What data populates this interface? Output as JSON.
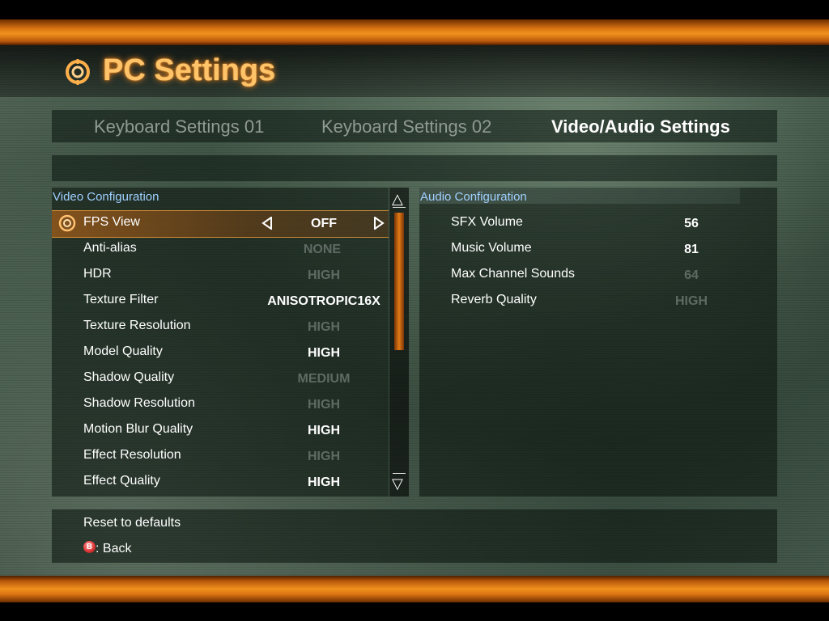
{
  "title": "PC Settings",
  "tabs": [
    {
      "label": "Keyboard Settings 01",
      "active": false
    },
    {
      "label": "Keyboard Settings 02",
      "active": false
    },
    {
      "label": "Video/Audio Settings",
      "active": true
    }
  ],
  "video": {
    "title": "Video Configuration",
    "rows": [
      {
        "label": "FPS View",
        "value": "OFF",
        "enabled": true,
        "selected": true
      },
      {
        "label": "Anti-alias",
        "value": "NONE",
        "enabled": false
      },
      {
        "label": "HDR",
        "value": "HIGH",
        "enabled": false
      },
      {
        "label": "Texture Filter",
        "value": "ANISOTROPIC16X",
        "enabled": true
      },
      {
        "label": "Texture Resolution",
        "value": "HIGH",
        "enabled": false
      },
      {
        "label": "Model Quality",
        "value": "HIGH",
        "enabled": true
      },
      {
        "label": "Shadow Quality",
        "value": "MEDIUM",
        "enabled": false
      },
      {
        "label": "Shadow Resolution",
        "value": "HIGH",
        "enabled": false
      },
      {
        "label": "Motion Blur Quality",
        "value": "HIGH",
        "enabled": true
      },
      {
        "label": "Effect Resolution",
        "value": "HIGH",
        "enabled": false
      },
      {
        "label": "Effect Quality",
        "value": "HIGH",
        "enabled": true
      }
    ]
  },
  "audio": {
    "title": "Audio Configuration",
    "rows": [
      {
        "label": "SFX Volume",
        "value": "56",
        "enabled": true
      },
      {
        "label": "Music Volume",
        "value": "81",
        "enabled": true
      },
      {
        "label": "Max Channel Sounds",
        "value": "64",
        "enabled": false
      },
      {
        "label": "Reverb Quality",
        "value": "HIGH",
        "enabled": false
      }
    ]
  },
  "footer": {
    "reset_label": "Reset to defaults",
    "back_button_glyph": "B",
    "back_label": ": Back"
  },
  "colors": {
    "accent_orange": "#e07a18",
    "title_glow": "#ffc46a",
    "section_title": "#9fd0ff",
    "disabled_value": "#5e6a63"
  }
}
